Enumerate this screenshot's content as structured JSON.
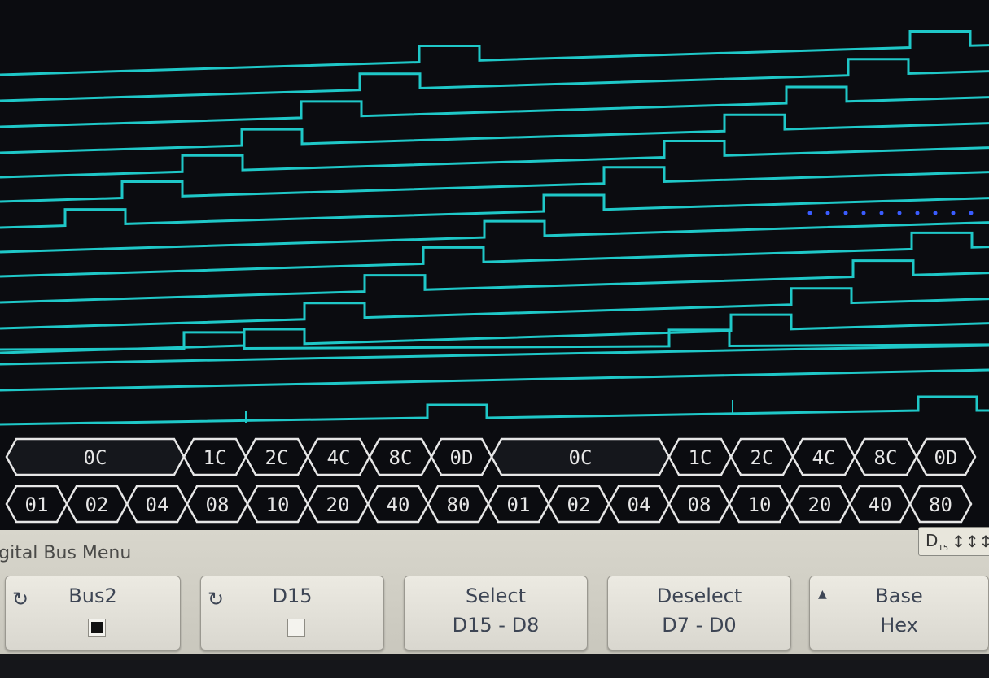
{
  "screen": {
    "trace_color": "#1fc8c8",
    "background_color": "#0b0c10",
    "decode_color": "#e6e6e6",
    "bus_row_upper": [
      "0C",
      "1C",
      "2C",
      "4C",
      "8C",
      "0D",
      "0C",
      "1C",
      "2C",
      "4C",
      "8C",
      "0D"
    ],
    "bus_row_lower": [
      "01",
      "02",
      "04",
      "08",
      "10",
      "20",
      "40",
      "80",
      "01",
      "02",
      "04",
      "08",
      "10",
      "20",
      "40",
      "80"
    ]
  },
  "menu": {
    "title": "igital Bus Menu",
    "indicator_label": "D",
    "indicator_sub": "15",
    "indicator_icon": "arrows-updown-icon",
    "softkeys": [
      {
        "line1": "Bus2",
        "line2": "",
        "checked": true,
        "icon": "cycle-icon"
      },
      {
        "line1": "D15",
        "line2": "",
        "checked": false,
        "icon": "cycle-icon"
      },
      {
        "line1": "Select",
        "line2": "D15 - D8"
      },
      {
        "line1": "Deselect",
        "line2": "D7 - D0"
      },
      {
        "line1": "Base",
        "line2": "Hex",
        "icon": "up-arrow-icon"
      }
    ]
  }
}
